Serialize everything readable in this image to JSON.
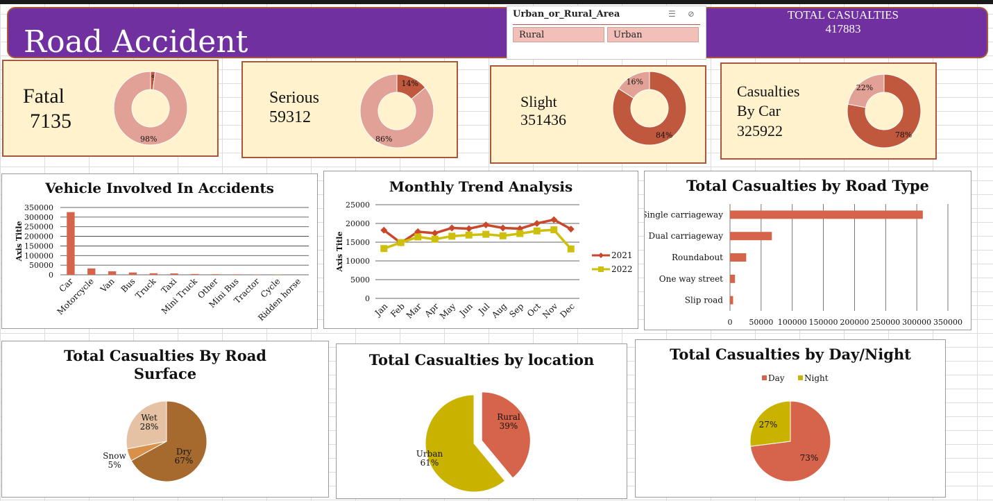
{
  "header": {
    "title": "Road Accident",
    "total_label": "TOTAL CASUALTIES",
    "total_value": "417883"
  },
  "slicer": {
    "title": "Urban_or_Rural_Area",
    "options": [
      "Rural",
      "Urban"
    ]
  },
  "kpis": [
    {
      "label": "Fatal",
      "value": "7135",
      "ring": [
        {
          "pct": 2,
          "label": "2%"
        },
        {
          "pct": 98,
          "label": "98%"
        }
      ]
    },
    {
      "label": "Serious",
      "value": "59312",
      "ring": [
        {
          "pct": 14,
          "label": "14%"
        },
        {
          "pct": 86,
          "label": "86%"
        }
      ]
    },
    {
      "label": "Slight",
      "value": "351436",
      "ring": [
        {
          "pct": 84,
          "label": "84%"
        },
        {
          "pct": 16,
          "label": "16%"
        }
      ]
    },
    {
      "label": "Casualties By Car",
      "label_lines": [
        "Casualties",
        "By Car"
      ],
      "value": "325922",
      "ring": [
        {
          "pct": 78,
          "label": "78%"
        },
        {
          "pct": 22,
          "label": "22%"
        }
      ]
    }
  ],
  "colors": {
    "accent": "#c0583e",
    "accent_light": "#e2a196",
    "bar": "#d5644a",
    "line2021": "#c9472b",
    "line2022": "#cdbf0c",
    "dry": "#a66a2e",
    "wet": "#e4c2a3",
    "snow": "#d9914a",
    "urban": "#c9b300",
    "rural": "#d5644a",
    "kpi_bg": "#fff2cc",
    "banner": "#7030a0"
  },
  "chart_data": [
    {
      "type": "bar",
      "title": "Vehicle Involved In Accidents",
      "ylabel": "Axis Title",
      "categories": [
        "Car",
        "Motorcycle",
        "Van",
        "Bus",
        "Truck",
        "Taxi",
        "Mini Truck",
        "Other",
        "Mini Bus",
        "Tractor",
        "Cycle",
        "Ridden horse"
      ],
      "values": [
        325922,
        33000,
        18000,
        12000,
        8000,
        7000,
        4000,
        3000,
        2500,
        2000,
        1500,
        500
      ],
      "ylim": [
        0,
        350000
      ],
      "yticks": [
        "0",
        "50000",
        "100000",
        "150000",
        "200000",
        "250000",
        "300000",
        "350000"
      ]
    },
    {
      "type": "line",
      "title": "Monthly Trend Analysis",
      "ylabel": "Axis Title",
      "categories": [
        "Jan",
        "Feb",
        "Mar",
        "Apr",
        "May",
        "Jun",
        "Jul",
        "Aug",
        "Sep",
        "Oct",
        "Nov",
        "Dec"
      ],
      "series": [
        {
          "name": "2021",
          "values": [
            18200,
            14800,
            17800,
            17400,
            18800,
            18600,
            19600,
            18800,
            18600,
            20000,
            21000,
            18500
          ]
        },
        {
          "name": "2022",
          "values": [
            13300,
            14900,
            16400,
            15800,
            16600,
            16900,
            17100,
            16700,
            17300,
            18000,
            18300,
            13200
          ]
        }
      ],
      "ylim": [
        0,
        25000
      ],
      "yticks": [
        "0",
        "5000",
        "10000",
        "15000",
        "20000",
        "25000"
      ]
    },
    {
      "type": "bar",
      "orientation": "horizontal",
      "title": "Total Casualties by Road Type",
      "categories": [
        "Single carriageway",
        "Dual carriageway",
        "Roundabout",
        "One way street",
        "Slip road"
      ],
      "values": [
        309698,
        67263,
        26000,
        8000,
        5000
      ],
      "xlim": [
        0,
        350000
      ],
      "xticks": [
        "0",
        "50000",
        "100000",
        "150000",
        "200000",
        "250000",
        "300000",
        "350000"
      ]
    },
    {
      "type": "pie",
      "title": "Total Casualties By Road Surface",
      "title_lines": [
        "Total Casualties By Road",
        "Surface"
      ],
      "slices": [
        {
          "name": "Dry",
          "pct": 67,
          "label": "67%"
        },
        {
          "name": "Snow",
          "pct": 5,
          "label": "5%"
        },
        {
          "name": "Wet",
          "pct": 28,
          "label": "28%"
        }
      ]
    },
    {
      "type": "pie",
      "title": "Total Casualties by location",
      "slices": [
        {
          "name": "Rural",
          "pct": 39,
          "label": "39%"
        },
        {
          "name": "Urban",
          "pct": 61,
          "label": "61%"
        }
      ]
    },
    {
      "type": "pie",
      "title": "Total Casualties by Day/Night",
      "legend": "top",
      "slices": [
        {
          "name": "Day",
          "pct": 73,
          "label": "73%"
        },
        {
          "name": "Night",
          "pct": 27,
          "label": "27%"
        }
      ]
    }
  ]
}
